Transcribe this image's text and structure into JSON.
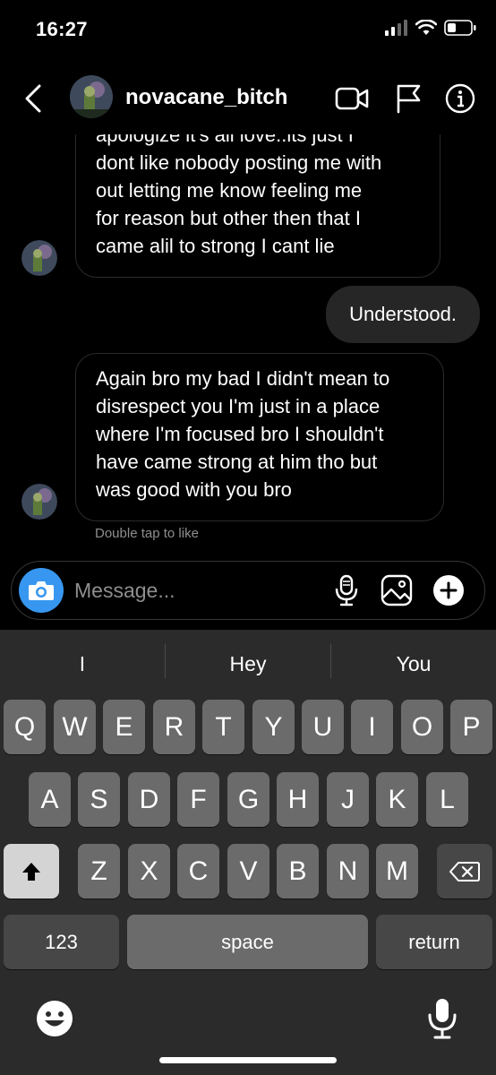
{
  "status_bar": {
    "time": "16:27"
  },
  "header": {
    "username": "novacane_bitch"
  },
  "messages": [
    {
      "direction": "incoming",
      "lines": [
        "apologize it's all love..its just I",
        "dont like nobody posting me with",
        "out letting me know feeling me",
        "for reason but other then that I",
        "came alil to strong I cant lie"
      ]
    },
    {
      "direction": "outgoing",
      "text": "Understood."
    },
    {
      "direction": "incoming",
      "lines": [
        "Again bro my bad I didn't mean to",
        "disrespect you I'm just in a place",
        "where I'm focused bro I shouldn't",
        "have came strong at him tho but",
        "was good with you bro"
      ]
    }
  ],
  "double_tap_hint": "Double tap to like",
  "composer": {
    "placeholder": "Message..."
  },
  "keyboard": {
    "suggestions": [
      "I",
      "Hey",
      "You"
    ],
    "row1": [
      "Q",
      "W",
      "E",
      "R",
      "T",
      "Y",
      "U",
      "I",
      "O",
      "P"
    ],
    "row2": [
      "A",
      "S",
      "D",
      "F",
      "G",
      "H",
      "J",
      "K",
      "L"
    ],
    "row3": [
      "Z",
      "X",
      "C",
      "V",
      "B",
      "N",
      "M"
    ],
    "numbers_label": "123",
    "space_label": "space",
    "return_label": "return"
  },
  "colors": {
    "accent_blue": "#3797f0",
    "bubble_outgoing": "#262626",
    "keyboard_bg": "#2b2b2b"
  }
}
